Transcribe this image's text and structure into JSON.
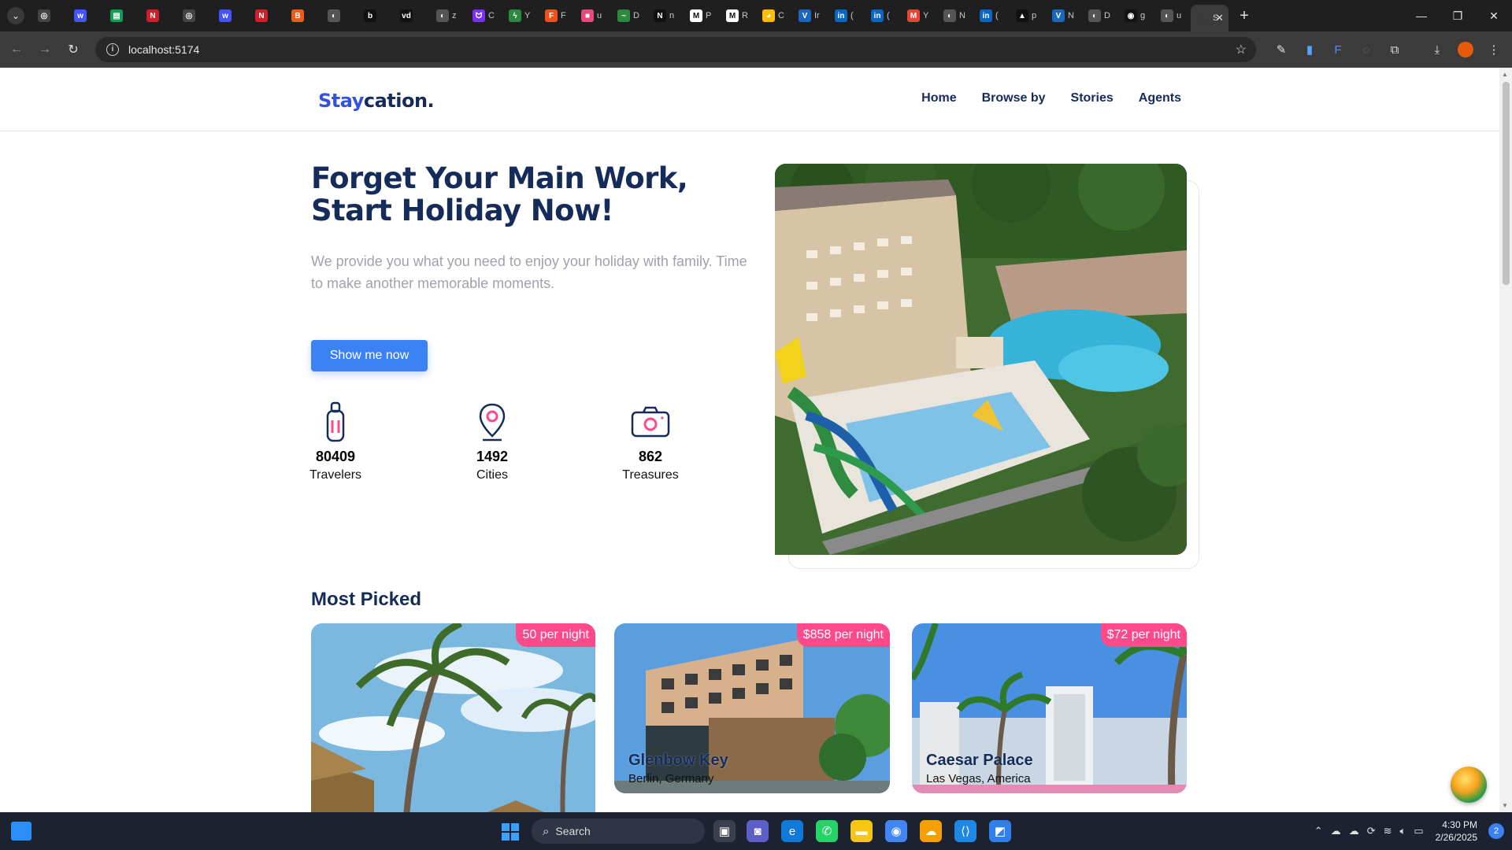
{
  "browser": {
    "tabs": [
      {
        "icon": "chatgpt-icon",
        "color": "#444444",
        "glyph": "◎",
        "title": ""
      },
      {
        "icon": "webflow-icon",
        "color": "#4353ff",
        "glyph": "w",
        "title": ""
      },
      {
        "icon": "sheets-icon",
        "color": "#0f9d58",
        "glyph": "▤",
        "title": ""
      },
      {
        "icon": "red-app-icon",
        "color": "#d11f2a",
        "glyph": "N",
        "title": ""
      },
      {
        "icon": "chatgpt-icon",
        "color": "#444444",
        "glyph": "◎",
        "title": ""
      },
      {
        "icon": "webflow-icon",
        "color": "#4353ff",
        "glyph": "w",
        "title": ""
      },
      {
        "icon": "red-app-icon",
        "color": "#d11f2a",
        "glyph": "N",
        "title": ""
      },
      {
        "icon": "brave-icon",
        "color": "#f5581a",
        "glyph": "B",
        "title": ""
      },
      {
        "icon": "globe-icon",
        "color": "#555555",
        "glyph": "◐",
        "title": ""
      },
      {
        "icon": "b-icon",
        "color": "#111111",
        "glyph": "b",
        "title": ""
      },
      {
        "icon": "vd-icon",
        "color": "#111111",
        "glyph": "vd",
        "title": ""
      },
      {
        "icon": "globe-icon",
        "color": "#555555",
        "glyph": "◐",
        "title": "z"
      },
      {
        "icon": "purple-circle-icon",
        "color": "#7b2ff7",
        "glyph": "ᗢ",
        "title": "C"
      },
      {
        "icon": "bolt-icon",
        "color": "#2b8a3e",
        "glyph": "ϟ",
        "title": "Y"
      },
      {
        "icon": "figma-icon",
        "color": "#f24e1e",
        "glyph": "F",
        "title": "F"
      },
      {
        "icon": "pink-square-icon",
        "color": "#e64980",
        "glyph": "■",
        "title": "u"
      },
      {
        "icon": "signature-icon",
        "color": "#2b8a3e",
        "glyph": "~",
        "title": "D"
      },
      {
        "icon": "notion-icon",
        "color": "#111111",
        "glyph": "N",
        "title": "n"
      },
      {
        "icon": "medium-icon",
        "color": "#ffffff",
        "glyph": "M",
        "title": "P"
      },
      {
        "icon": "medium-icon",
        "color": "#ffffff",
        "glyph": "M",
        "title": "R"
      },
      {
        "icon": "chrome-icon",
        "color": "#fbbc04",
        "glyph": "◕",
        "title": "C"
      },
      {
        "icon": "vuetify-icon",
        "color": "#1867c0",
        "glyph": "V",
        "title": "Ir"
      },
      {
        "icon": "linkedin-icon",
        "color": "#0a66c2",
        "glyph": "in",
        "title": "("
      },
      {
        "icon": "linkedin-icon",
        "color": "#0a66c2",
        "glyph": "in",
        "title": "("
      },
      {
        "icon": "gmail-icon",
        "color": "#ea4335",
        "glyph": "M",
        "title": "Y"
      },
      {
        "icon": "globe-icon",
        "color": "#555555",
        "glyph": "◐",
        "title": "N"
      },
      {
        "icon": "linkedin-icon",
        "color": "#0a66c2",
        "glyph": "in",
        "title": "("
      },
      {
        "icon": "triangle-icon",
        "color": "#111111",
        "glyph": "▲",
        "title": "p"
      },
      {
        "icon": "vuetify-icon",
        "color": "#1867c0",
        "glyph": "V",
        "title": "N"
      },
      {
        "icon": "globe-icon",
        "color": "#555555",
        "glyph": "◐",
        "title": "D"
      },
      {
        "icon": "github-icon",
        "color": "#111111",
        "glyph": "◉",
        "title": "g"
      },
      {
        "icon": "globe-icon",
        "color": "#555555",
        "glyph": "◐",
        "title": "u"
      },
      {
        "icon": "staycation-icon",
        "color": "#3b3b3b",
        "glyph": "",
        "title": "S"
      }
    ],
    "url": "localhost:5174"
  },
  "site": {
    "brand_accent": "Stay",
    "brand_rest": "cation.",
    "nav": [
      "Home",
      "Browse by",
      "Stories",
      "Agents"
    ],
    "hero": {
      "title": "Forget Your Main Work, Start Holiday Now!",
      "description": "We provide you what you need to enjoy your holiday with family. Time to make another memorable moments.",
      "cta": "Show me now"
    },
    "stats": [
      {
        "icon": "luggage-icon",
        "value": "80409",
        "label": "Travelers"
      },
      {
        "icon": "map-pin-icon",
        "value": "1492",
        "label": "Cities"
      },
      {
        "icon": "camera-icon",
        "value": "862",
        "label": "Treasures"
      }
    ],
    "most_picked_heading": "Most Picked",
    "cards": [
      {
        "price": "50 per night",
        "name": "",
        "location": ""
      },
      {
        "price": "$858 per night",
        "name": "Glenbow Key",
        "location": "Berlin, Germany"
      },
      {
        "price": "$72 per night",
        "name": "Caesar Palace",
        "location": "Las Vegas, America"
      }
    ],
    "colors": {
      "primary": "#152c5b",
      "accent": "#3b82f6",
      "badge": "#ff498b",
      "muted": "#a0a0b0"
    }
  },
  "taskbar": {
    "search_placeholder": "Search",
    "time": "4:30 PM",
    "date": "2/26/2025",
    "notifications": "2"
  }
}
